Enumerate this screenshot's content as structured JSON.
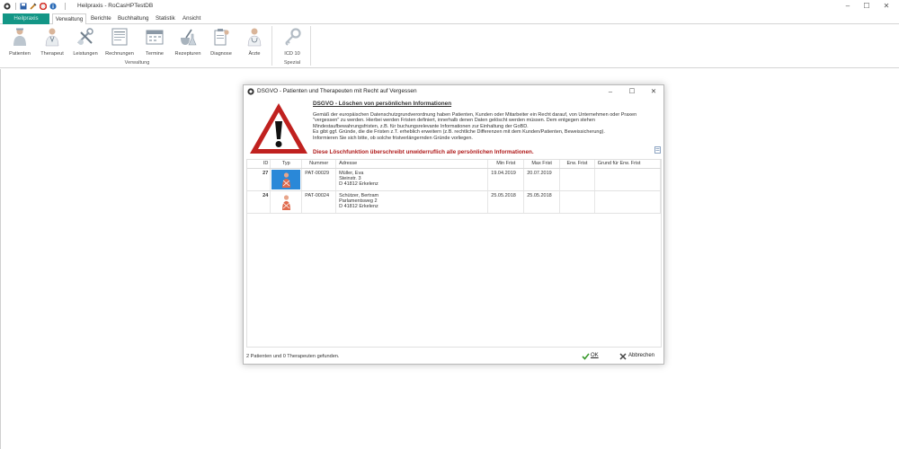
{
  "window": {
    "title": "Heilpraxis - RoCasHPTestDB"
  },
  "ribbon_tabs": {
    "file": "Heilpraxis",
    "tabs": [
      "Verwaltung",
      "Berichte",
      "Buchhaltung",
      "Statistik",
      "Ansicht"
    ]
  },
  "ribbon": {
    "verwaltung_buttons": [
      "Patienten",
      "Therapeut",
      "Leistungen",
      "Rechnungen",
      "Termine",
      "Rezepturen",
      "Diagnose",
      "Ärzte"
    ],
    "verwaltung_group": "Verwaltung",
    "spezial_buttons": [
      "ICD 10"
    ],
    "spezial_group": "Spezial"
  },
  "dialog": {
    "title": "DSGVO - Patienten und Therapeuten mit Recht auf Vergessen",
    "heading": "DSGVO - Löschen von persönlichen Informationen",
    "body": [
      "Gemäß der europäischen Datenschutzgrundverordnung haben Patienten, Kunden oder Mitarbeiter ein Recht darauf, von Unternehmen oder Praxen",
      "\"vergessen\" zu werden. Hierbei werden Fristen definiert, innerhalb denen Daten gelöscht werden müssen. Dem entgegen stehen",
      "Mindestaufbewahrungsfristen, z.B. für buchungsrelevante Informationen zur Einhaltung der GoBD.",
      "Es gibt ggf. Gründe, die die Fristen z.T. erheblich erweitern (z.B. rechtliche Differenzen mit dem Kunden/Patienten, Beweissicherung).",
      "Informieren Sie sich bitte, ob solche fristverlängernden Gründe vorliegen."
    ],
    "warning": "Diese Löschfunktion überschreibt unwiderruflich alle persönlichen Informationen.",
    "columns": [
      "ID",
      "Typ",
      "Nummer",
      "Adresse",
      "Min Frist",
      "Max Frist",
      "Erw. Frist",
      "Grund für Erw. Frist"
    ],
    "rows": [
      {
        "id": "27",
        "selected": true,
        "nummer": "PAT-00029",
        "adresse": [
          "Müller, Eva",
          "Steinstr. 3",
          "D 41812 Erkelenz"
        ],
        "min_frist": "19.04.2019",
        "max_frist": "20.07.2019",
        "erw_frist": "",
        "grund": ""
      },
      {
        "id": "24",
        "selected": false,
        "nummer": "PAT-00024",
        "adresse": [
          "Schützer, Bertram",
          "Parlamentsweg 2",
          "D 41812 Erkelenz"
        ],
        "min_frist": "25.05.2018",
        "max_frist": "25.05.2018",
        "erw_frist": "",
        "grund": ""
      }
    ],
    "status": "2 Patienten und 0 Therapeuten gefunden.",
    "ok_label": "OK",
    "cancel_label": "Abbrechen"
  },
  "colors": {
    "accent": "#139686",
    "selection": "#2a88d8",
    "warning_text": "#b01b1b",
    "warning_icon": "#c0211f"
  }
}
